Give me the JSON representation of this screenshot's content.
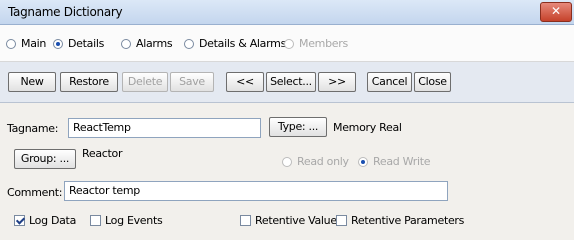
{
  "window": {
    "title": "Tagname Dictionary",
    "close_glyph": "✕"
  },
  "tabs": [
    {
      "label": "Main",
      "selected": false,
      "enabled": true
    },
    {
      "label": "Details",
      "selected": true,
      "enabled": true
    },
    {
      "label": "Alarms",
      "selected": false,
      "enabled": true
    },
    {
      "label": "Details & Alarms",
      "selected": false,
      "enabled": true
    },
    {
      "label": "Members",
      "selected": false,
      "enabled": false
    }
  ],
  "toolbar": {
    "new": "New",
    "restore": "Restore",
    "delete": "Delete",
    "save": "Save",
    "prev": "<<",
    "select": "Select...",
    "next": ">>",
    "cancel": "Cancel",
    "close": "Close"
  },
  "form": {
    "tagname_label": "Tagname:",
    "tagname_value": "ReactTemp",
    "type_button": "Type: ...",
    "type_value": "Memory Real",
    "group_button": "Group: ...",
    "group_value": "Reactor",
    "read_only": "Read only",
    "read_write": "Read Write",
    "comment_label": "Comment:",
    "comment_value": "Reactor temp"
  },
  "options": {
    "log_data": "Log Data",
    "log_events": "Log Events",
    "retentive_value": "Retentive Value",
    "retentive_parameters": "Retentive Parameters"
  }
}
